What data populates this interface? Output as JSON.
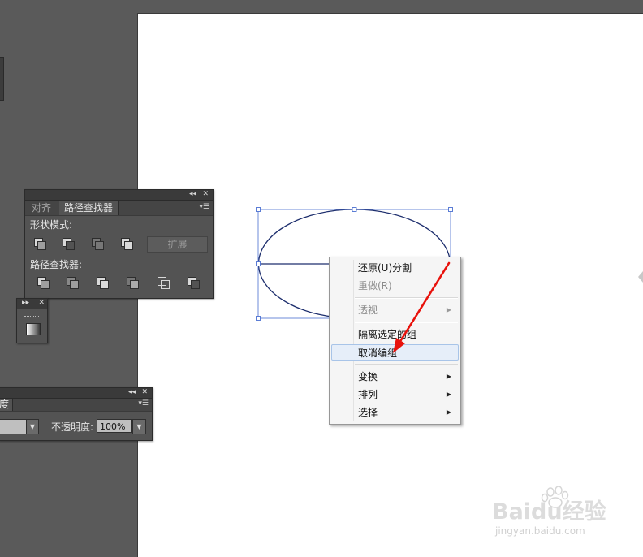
{
  "pathfinder_panel": {
    "tabs": [
      {
        "label": "对齐",
        "active": false
      },
      {
        "label": "路径查找器",
        "active": true
      }
    ],
    "shape_modes_label": "形状模式:",
    "expand_label": "扩展",
    "pathfinders_label": "路径查找器:",
    "shape_mode_icons": [
      "unite-icon",
      "minus-front-icon",
      "intersect-icon",
      "exclude-icon"
    ],
    "pathfinder_icons": [
      "divide-icon",
      "trim-icon",
      "merge-icon",
      "crop-icon",
      "outline-icon",
      "minus-back-icon"
    ]
  },
  "transparency_panel": {
    "tab_fragment": "度",
    "opacity_label": "不透明度:",
    "opacity_value": "100%"
  },
  "context_menu": {
    "items": [
      {
        "label": "还原(U)分割",
        "enabled": true,
        "submenu": false
      },
      {
        "label": "重做(R)",
        "enabled": false,
        "submenu": false
      },
      {
        "label": "透视",
        "enabled": false,
        "submenu": true
      },
      {
        "label": "隔离选定的组",
        "enabled": true,
        "submenu": false
      },
      {
        "label": "取消编组",
        "enabled": true,
        "submenu": false,
        "highlighted": true
      },
      {
        "label": "变换",
        "enabled": true,
        "submenu": true
      },
      {
        "label": "排列",
        "enabled": true,
        "submenu": true
      },
      {
        "label": "选择",
        "enabled": true,
        "submenu": true
      }
    ]
  },
  "colors": {
    "workspace": "#5a5a5a",
    "panel": "#535353",
    "artboard": "#ffffff",
    "selection": "#4a6fd1",
    "ellipse_stroke": "#1e2f6e",
    "annotation_arrow": "#e8120c"
  },
  "watermark": {
    "main": "Baidu经验",
    "sub": "jingyan.baidu.com"
  }
}
